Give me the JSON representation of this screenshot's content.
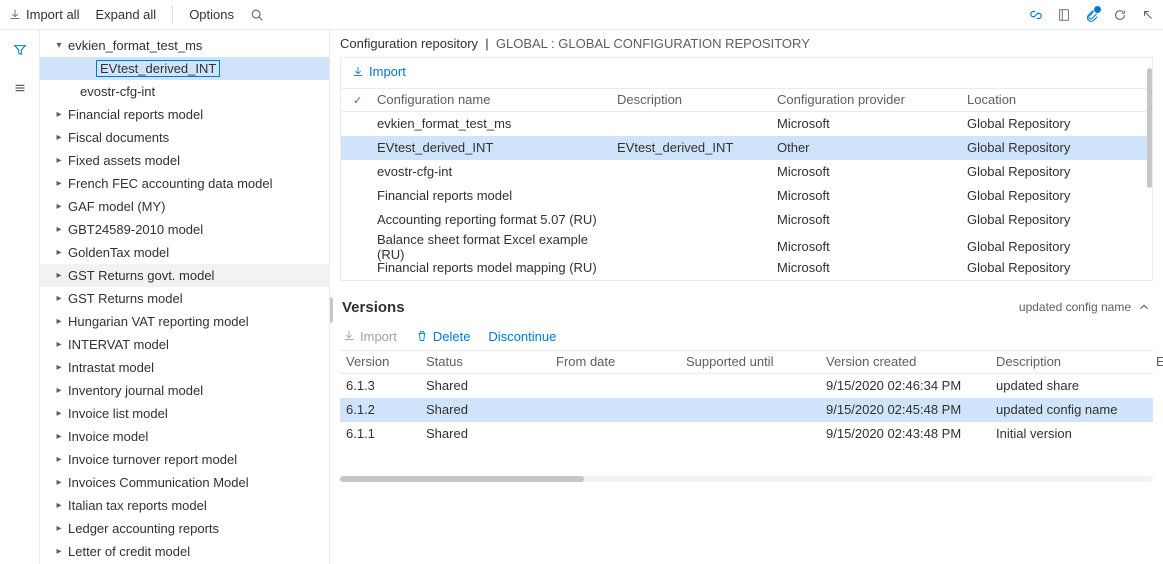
{
  "toolbar": {
    "import_all": "Import all",
    "expand_all": "Expand all",
    "options": "Options"
  },
  "breadcrumb": {
    "left": "Configuration repository",
    "right": "GLOBAL : GLOBAL CONFIGURATION REPOSITORY"
  },
  "tree": [
    {
      "level": 0,
      "exp": "down",
      "label": "evkien_format_test_ms"
    },
    {
      "level": 2,
      "exp": "",
      "label": "EVtest_derived_INT",
      "selected": true
    },
    {
      "level": 1,
      "exp": "",
      "label": "evostr-cfg-int"
    },
    {
      "level": 0,
      "exp": "right",
      "label": "Financial reports model"
    },
    {
      "level": 0,
      "exp": "right",
      "label": "Fiscal documents"
    },
    {
      "level": 0,
      "exp": "right",
      "label": "Fixed assets model"
    },
    {
      "level": 0,
      "exp": "right",
      "label": "French FEC accounting data model"
    },
    {
      "level": 0,
      "exp": "right",
      "label": "GAF model (MY)"
    },
    {
      "level": 0,
      "exp": "right",
      "label": "GBT24589-2010 model"
    },
    {
      "level": 0,
      "exp": "right",
      "label": "GoldenTax model"
    },
    {
      "level": 0,
      "exp": "right",
      "label": "GST Returns govt. model",
      "highlight": true
    },
    {
      "level": 0,
      "exp": "right",
      "label": "GST Returns model"
    },
    {
      "level": 0,
      "exp": "right",
      "label": "Hungarian VAT reporting model"
    },
    {
      "level": 0,
      "exp": "right",
      "label": "INTERVAT model"
    },
    {
      "level": 0,
      "exp": "right",
      "label": "Intrastat model"
    },
    {
      "level": 0,
      "exp": "right",
      "label": "Inventory journal model"
    },
    {
      "level": 0,
      "exp": "right",
      "label": "Invoice list model"
    },
    {
      "level": 0,
      "exp": "right",
      "label": "Invoice model"
    },
    {
      "level": 0,
      "exp": "right",
      "label": "Invoice turnover report model"
    },
    {
      "level": 0,
      "exp": "right",
      "label": "Invoices Communication Model"
    },
    {
      "level": 0,
      "exp": "right",
      "label": "Italian tax reports model"
    },
    {
      "level": 0,
      "exp": "right",
      "label": "Ledger accounting reports"
    },
    {
      "level": 0,
      "exp": "right",
      "label": "Letter of credit model"
    }
  ],
  "config_panel": {
    "import": "Import",
    "headers": {
      "name": "Configuration name",
      "desc": "Description",
      "provider": "Configuration provider",
      "location": "Location"
    },
    "rows": [
      {
        "name": "evkien_format_test_ms",
        "desc": "",
        "provider": "Microsoft",
        "location": "Global Repository"
      },
      {
        "name": "EVtest_derived_INT",
        "desc": "EVtest_derived_INT",
        "provider": "Other",
        "location": "Global Repository",
        "sel": true
      },
      {
        "name": "evostr-cfg-int",
        "desc": "",
        "provider": "Microsoft",
        "location": "Global Repository"
      },
      {
        "name": "Financial reports model",
        "desc": "",
        "provider": "Microsoft",
        "location": "Global Repository"
      },
      {
        "name": "Accounting reporting format 5.07 (RU)",
        "desc": "",
        "provider": "Microsoft",
        "location": "Global Repository"
      },
      {
        "name": "Balance sheet format Excel example (RU)",
        "desc": "",
        "provider": "Microsoft",
        "location": "Global Repository"
      },
      {
        "name": "Financial reports model mapping (RU)",
        "desc": "",
        "provider": "Microsoft",
        "location": "Global Repository"
      }
    ]
  },
  "versions": {
    "title": "Versions",
    "subtitle": "updated config name",
    "import": "Import",
    "delete": "Delete",
    "discontinue": "Discontinue",
    "headers": {
      "version": "Version",
      "status": "Status",
      "from": "From date",
      "until": "Supported until",
      "created": "Version created",
      "desc": "Description",
      "e": "E"
    },
    "rows": [
      {
        "v": "6.1.3",
        "status": "Shared",
        "from": "",
        "until": "",
        "created": "9/15/2020 02:46:34 PM",
        "desc": "updated share"
      },
      {
        "v": "6.1.2",
        "status": "Shared",
        "from": "",
        "until": "",
        "created": "9/15/2020 02:45:48 PM",
        "desc": "updated config name",
        "sel": true
      },
      {
        "v": "6.1.1",
        "status": "Shared",
        "from": "",
        "until": "",
        "created": "9/15/2020 02:43:48 PM",
        "desc": "Initial version"
      }
    ]
  }
}
